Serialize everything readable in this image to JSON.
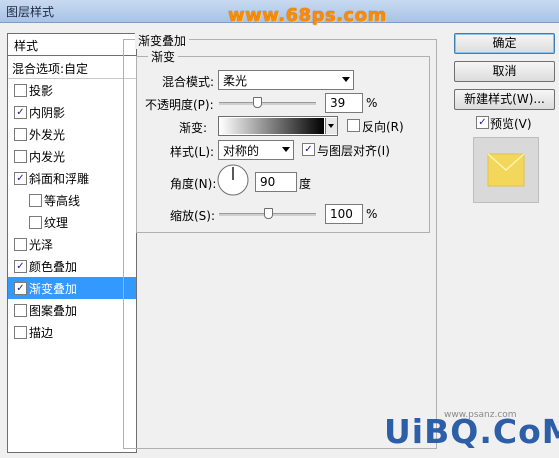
{
  "window": {
    "title": "图层样式",
    "watermark": "www.68ps.com"
  },
  "left_panel": {
    "header": "样式",
    "blend_options": "混合选项:自定",
    "items": [
      {
        "label": "投影",
        "checked": false
      },
      {
        "label": "内阴影",
        "checked": true
      },
      {
        "label": "外发光",
        "checked": false
      },
      {
        "label": "内发光",
        "checked": false
      },
      {
        "label": "斜面和浮雕",
        "checked": true
      },
      {
        "label": "等高线",
        "checked": false
      },
      {
        "label": "纹理",
        "checked": false
      },
      {
        "label": "光泽",
        "checked": false
      },
      {
        "label": "颜色叠加",
        "checked": true
      },
      {
        "label": "渐变叠加",
        "checked": true,
        "selected": true
      },
      {
        "label": "图案叠加",
        "checked": false
      },
      {
        "label": "描边",
        "checked": false
      }
    ]
  },
  "gradient_overlay": {
    "group_title": "渐变叠加",
    "subgroup_title": "渐变",
    "blend_mode_label": "混合模式:",
    "blend_mode_value": "柔光",
    "opacity_label": "不透明度(P):",
    "opacity_value": "39",
    "opacity_unit": "%",
    "opacity_level": 0.39,
    "gradient_label": "渐变:",
    "reverse_label": "反向(R)",
    "reverse_checked": false,
    "style_label": "样式(L):",
    "style_value": "对称的",
    "align_label": "与图层对齐(I)",
    "align_checked": true,
    "angle_label": "角度(N):",
    "angle_value": "90",
    "angle_unit": "度",
    "scale_label": "缩放(S):",
    "scale_value": "100",
    "scale_unit": "%",
    "scale_level": 0.5
  },
  "right_panel": {
    "ok": "确定",
    "cancel": "取消",
    "new_style": "新建样式(W)...",
    "preview_label": "预览(V)",
    "preview_checked": true
  },
  "footer_watermark": {
    "main": "UiBQ.CoM",
    "small": "www.psanz.com"
  },
  "check_glyph": "✓"
}
